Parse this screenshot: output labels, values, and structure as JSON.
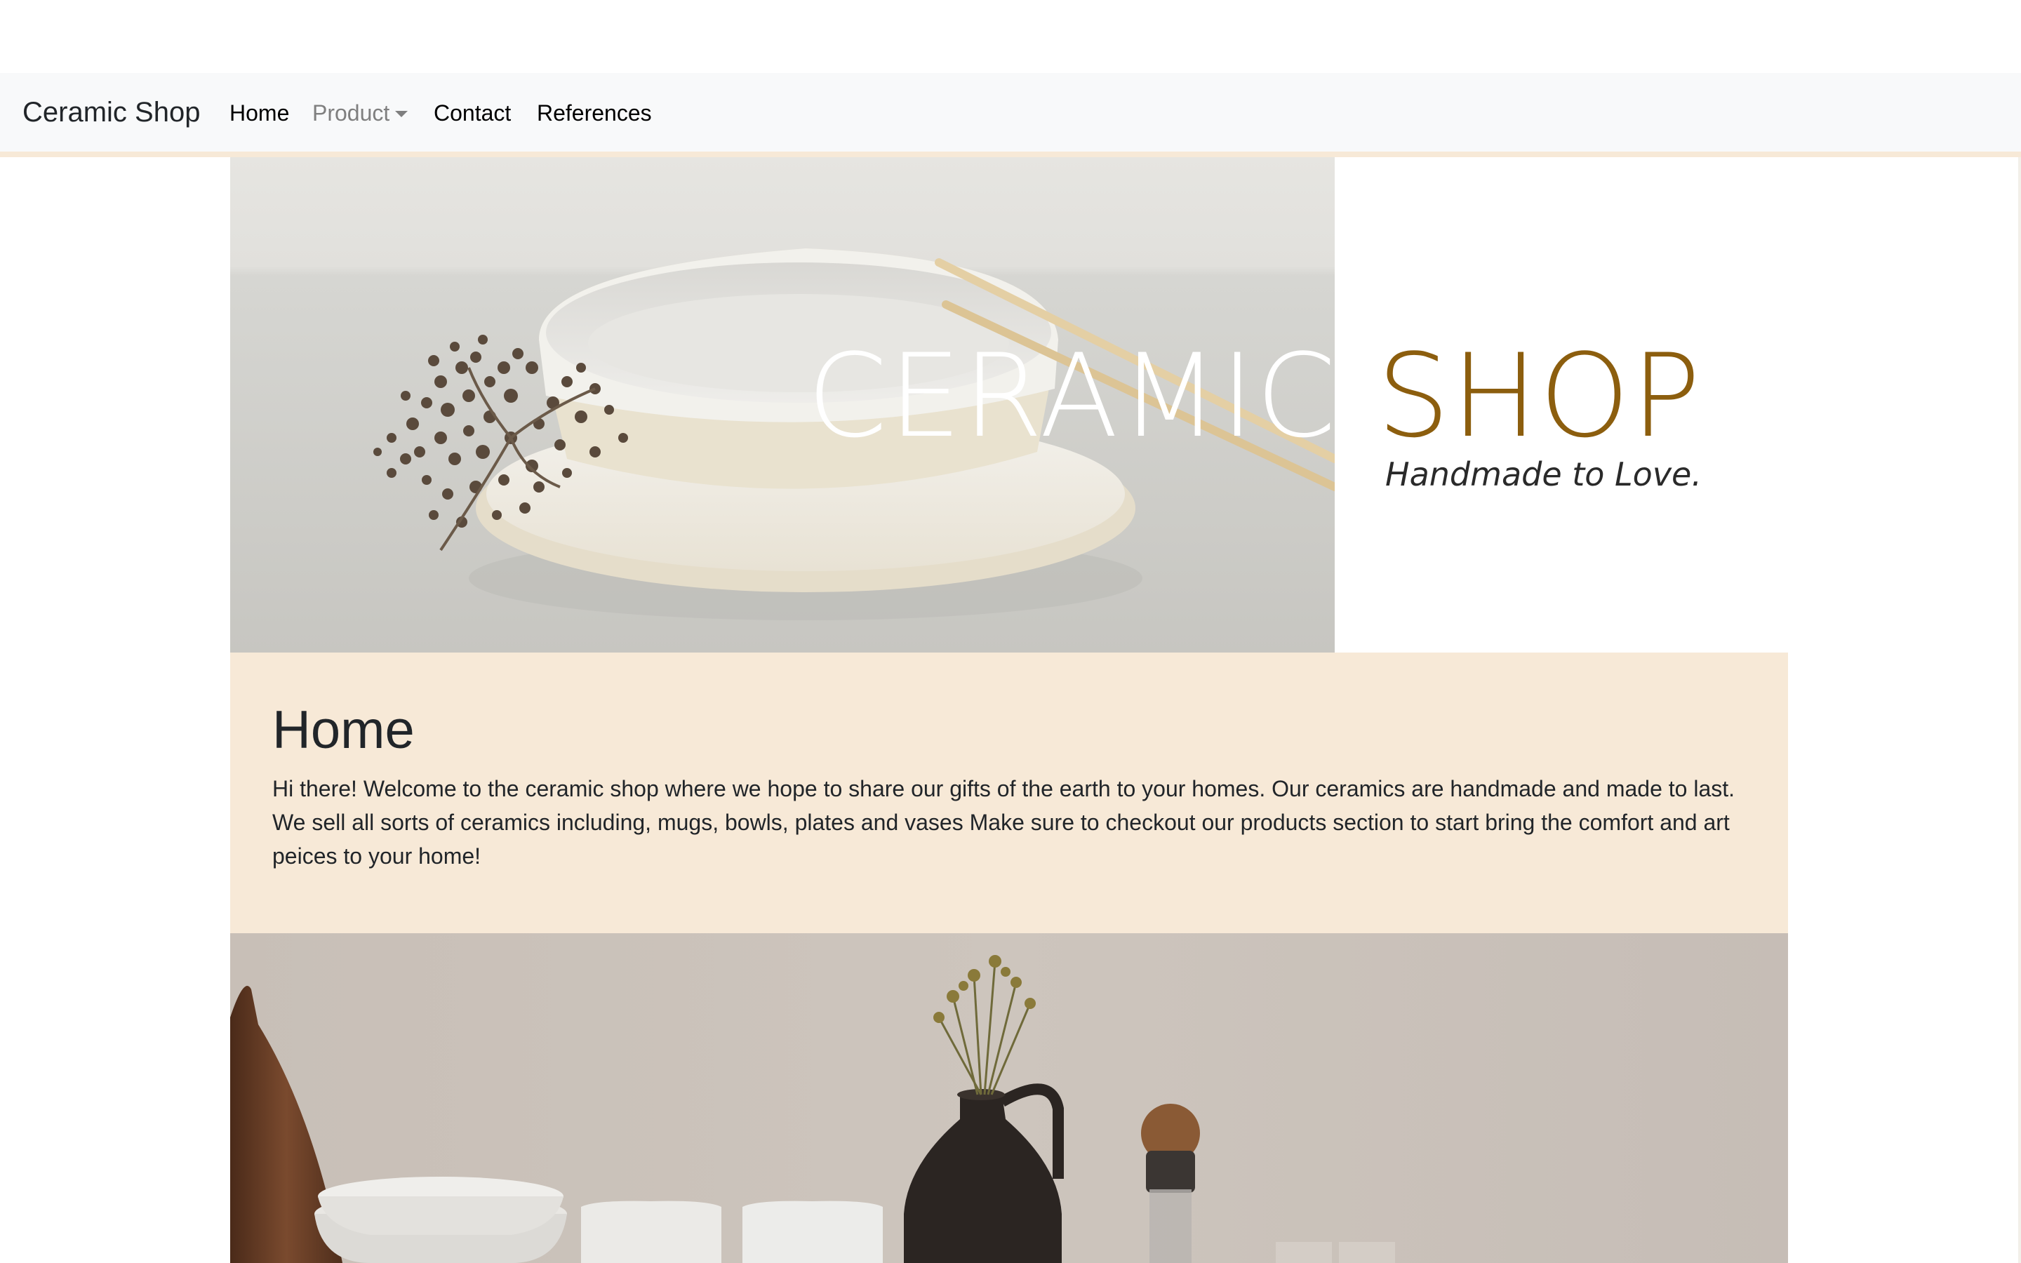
{
  "navbar": {
    "brand": "Ceramic Shop",
    "items": [
      {
        "label": "Home"
      },
      {
        "label": "Product"
      },
      {
        "label": "Contact"
      },
      {
        "label": "References"
      }
    ]
  },
  "hero": {
    "title_word1": "CERAMIC",
    "title_word2": "SHOP",
    "subtitle": "Handmade to Love.",
    "accent_color": "#8c5e0e"
  },
  "home": {
    "title": "Home",
    "text": "Hi there! Welcome to the ceramic shop where we hope to share our gifts of the earth to your homes. Our ceramics are handmade and made to last. We sell all sorts of ceramics including, mugs, bowls, plates and vases Make sure to checkout our products section to start bring the comfort and art peices to your home!",
    "background": "#f7e9d7"
  }
}
